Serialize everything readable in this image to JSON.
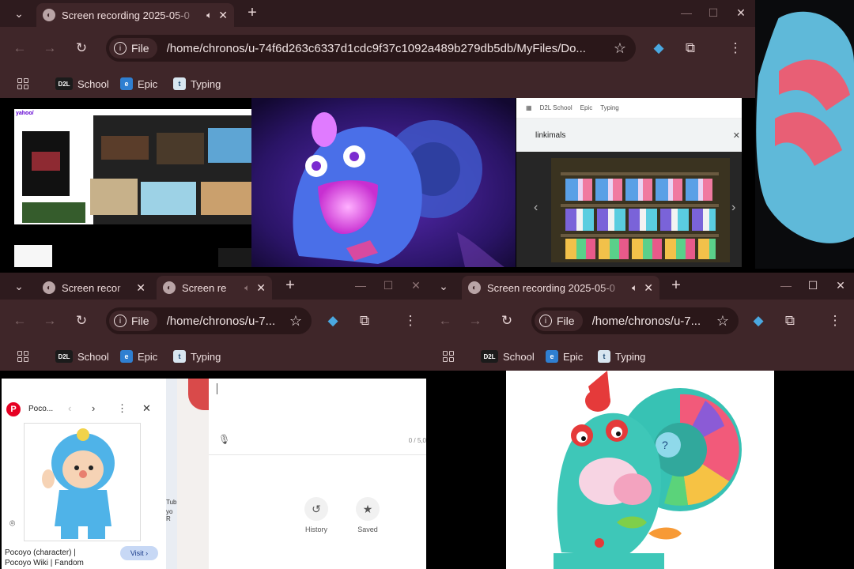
{
  "windows": {
    "top": {
      "tab_title": "Screen recording 2025-05-0",
      "url": "/home/chronos/u-74f6d263c6337d1cdc9f37c1092a489b279db5db/MyFiles/Do...",
      "file_chip": "File"
    },
    "bottom_left": {
      "tabs": [
        {
          "title": "Screen recor"
        },
        {
          "title": "Screen re"
        }
      ],
      "url": "/home/chronos/u-7...",
      "file_chip": "File"
    },
    "bottom_right": {
      "tab_title": "Screen recording 2025-05-0",
      "url": "/home/chronos/u-7...",
      "file_chip": "File"
    }
  },
  "bookmarks": [
    {
      "label": "School",
      "icon": "D2L"
    },
    {
      "label": "Epic",
      "icon": "epic-icon"
    },
    {
      "label": "Typing",
      "icon": "t"
    }
  ],
  "nested_search": {
    "query": "linkimals"
  },
  "bottom_left_content": {
    "side_title": "Poco...",
    "caption": "Pocoyo (character) |",
    "caption2": "Pocoyo Wiki | Fandom",
    "visit_button": "Visit",
    "counter": "0 / 5,0",
    "history_label": "History",
    "saved_label": "Saved",
    "partial_text1": "Tub",
    "partial_text2": "yo R"
  },
  "colors": {
    "chrome_dark": "#2e1b1e",
    "chrome": "#3f2629",
    "omnibox": "#2a1719",
    "accent_blue": "#4aa8e0"
  }
}
